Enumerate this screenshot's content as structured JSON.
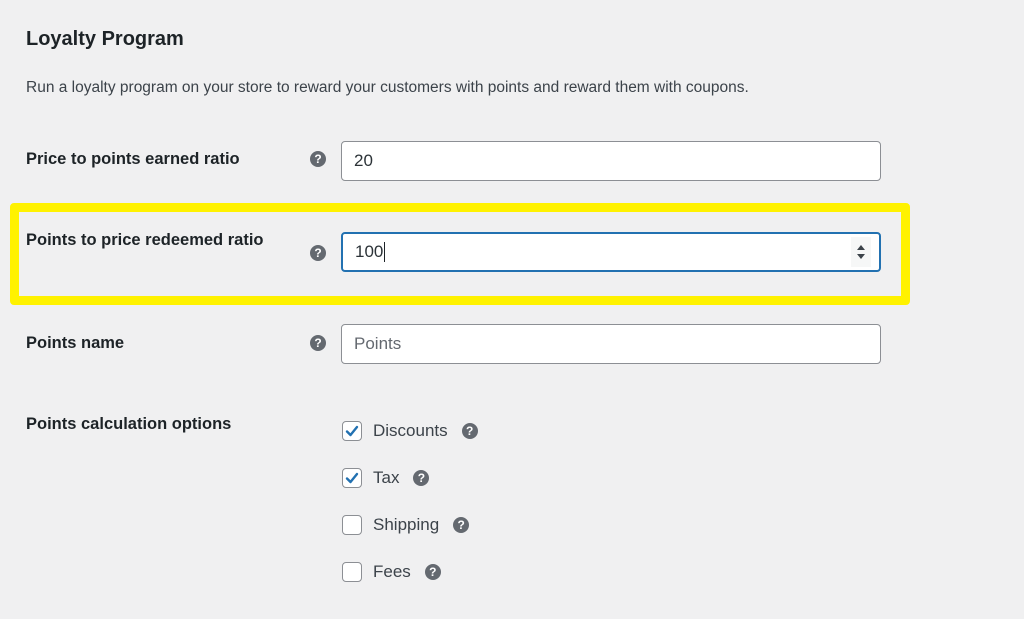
{
  "section": {
    "title": "Loyalty Program",
    "description": "Run a loyalty program on your store to reward your customers with points and reward them with coupons."
  },
  "fields": [
    {
      "label": "Price to points earned ratio",
      "value": "20",
      "placeholder": "",
      "help_icon": "help-icon"
    },
    {
      "label": "Points to price redeemed ratio",
      "value": "100",
      "placeholder": "",
      "focused": true,
      "highlighted": true,
      "help_icon": "help-icon"
    },
    {
      "label": "Points name",
      "value": "",
      "placeholder": "Points",
      "help_icon": "help-icon"
    }
  ],
  "calculation_options": {
    "label": "Points calculation options",
    "options": [
      {
        "label": "Discounts",
        "checked": true
      },
      {
        "label": "Tax",
        "checked": true
      },
      {
        "label": "Shipping",
        "checked": false
      },
      {
        "label": "Fees",
        "checked": false
      }
    ]
  },
  "icons": {
    "help": "?"
  },
  "colors": {
    "highlight": "#fff200",
    "focus": "#2271b1",
    "check": "#2271b1"
  }
}
